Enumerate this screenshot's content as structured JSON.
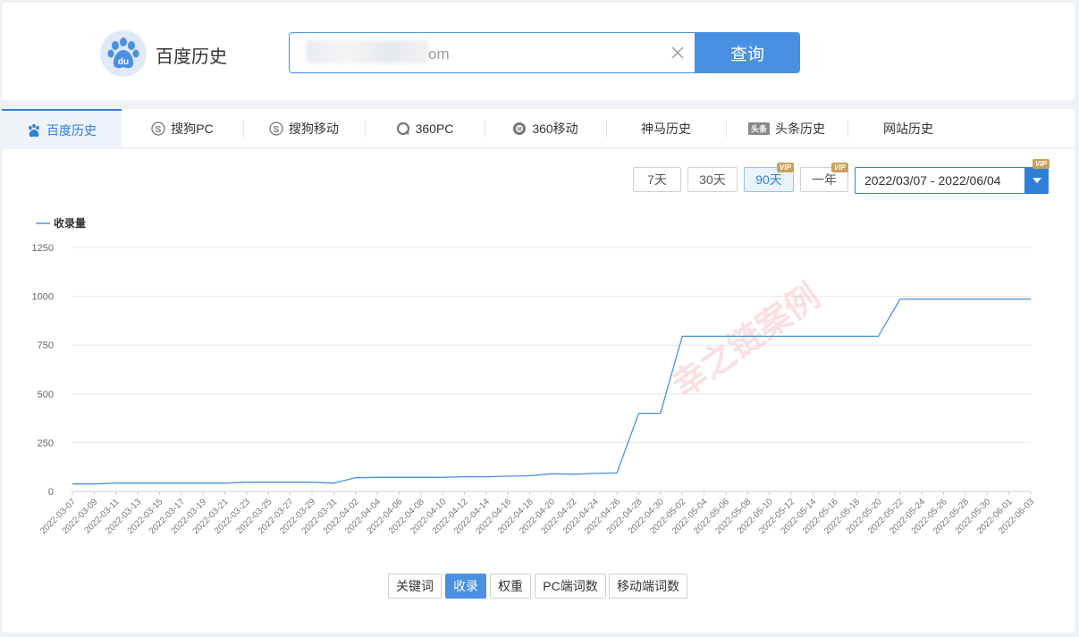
{
  "header": {
    "brand_title": "百度历史",
    "search_value": "om",
    "search_button": "查询",
    "logo_text": "du"
  },
  "tabs": [
    {
      "label": "百度历史",
      "icon": "paw-icon",
      "active": true
    },
    {
      "label": "搜狗PC",
      "icon": "sogou-icon"
    },
    {
      "label": "搜狗移动",
      "icon": "sogou-icon"
    },
    {
      "label": "360PC",
      "icon": "360-icon"
    },
    {
      "label": "360移动",
      "icon": "360-mobile-icon"
    },
    {
      "label": "神马历史",
      "icon": ""
    },
    {
      "label": "头条历史",
      "icon": "toutiao-icon"
    },
    {
      "label": "网站历史",
      "icon": ""
    }
  ],
  "ranges": [
    {
      "label": "7天",
      "vip": false,
      "active": false
    },
    {
      "label": "30天",
      "vip": false,
      "active": false
    },
    {
      "label": "90天",
      "vip": true,
      "active": true
    },
    {
      "label": "一年",
      "vip": true,
      "active": false
    }
  ],
  "vip_badge": "VIP",
  "date_range": "2022/03/07 - 2022/06/04",
  "watermark": "幸之链案例",
  "metrics": [
    {
      "label": "关键词",
      "active": false
    },
    {
      "label": "收录",
      "active": true
    },
    {
      "label": "权重",
      "active": false
    },
    {
      "label": "PC端词数",
      "active": false
    },
    {
      "label": "移动端词数",
      "active": false
    }
  ],
  "colors": {
    "accent": "#4a90e2",
    "series": "#4a90e2",
    "vip": "#c9a25a"
  },
  "chart_data": {
    "type": "line",
    "legend": "收录量",
    "legend_position": "top-left",
    "grid": true,
    "ylim": [
      0,
      1250
    ],
    "yticks": [
      0,
      250,
      500,
      750,
      1000,
      1250
    ],
    "x": [
      "2022-03-07",
      "2022-03-09",
      "2022-03-11",
      "2022-03-13",
      "2022-03-15",
      "2022-03-17",
      "2022-03-19",
      "2022-03-21",
      "2022-03-23",
      "2022-03-25",
      "2022-03-27",
      "2022-03-29",
      "2022-03-31",
      "2022-04-02",
      "2022-04-04",
      "2022-04-06",
      "2022-04-08",
      "2022-04-10",
      "2022-04-12",
      "2022-04-14",
      "2022-04-16",
      "2022-04-18",
      "2022-04-20",
      "2022-04-22",
      "2022-04-24",
      "2022-04-26",
      "2022-04-28",
      "2022-04-30",
      "2022-05-02",
      "2022-05-04",
      "2022-05-06",
      "2022-05-08",
      "2022-05-10",
      "2022-05-12",
      "2022-05-14",
      "2022-05-16",
      "2022-05-18",
      "2022-05-20",
      "2022-05-22",
      "2022-05-24",
      "2022-05-26",
      "2022-05-28",
      "2022-05-30",
      "2022-06-01",
      "2022-06-03"
    ],
    "series": [
      {
        "name": "收录量",
        "values": [
          38,
          38,
          42,
          42,
          42,
          42,
          42,
          42,
          47,
          47,
          47,
          47,
          42,
          70,
          72,
          72,
          72,
          72,
          75,
          75,
          78,
          80,
          90,
          88,
          92,
          95,
          400,
          400,
          795,
          795,
          795,
          795,
          795,
          795,
          795,
          795,
          795,
          795,
          985,
          985,
          985,
          985,
          985,
          985,
          985
        ]
      }
    ]
  }
}
